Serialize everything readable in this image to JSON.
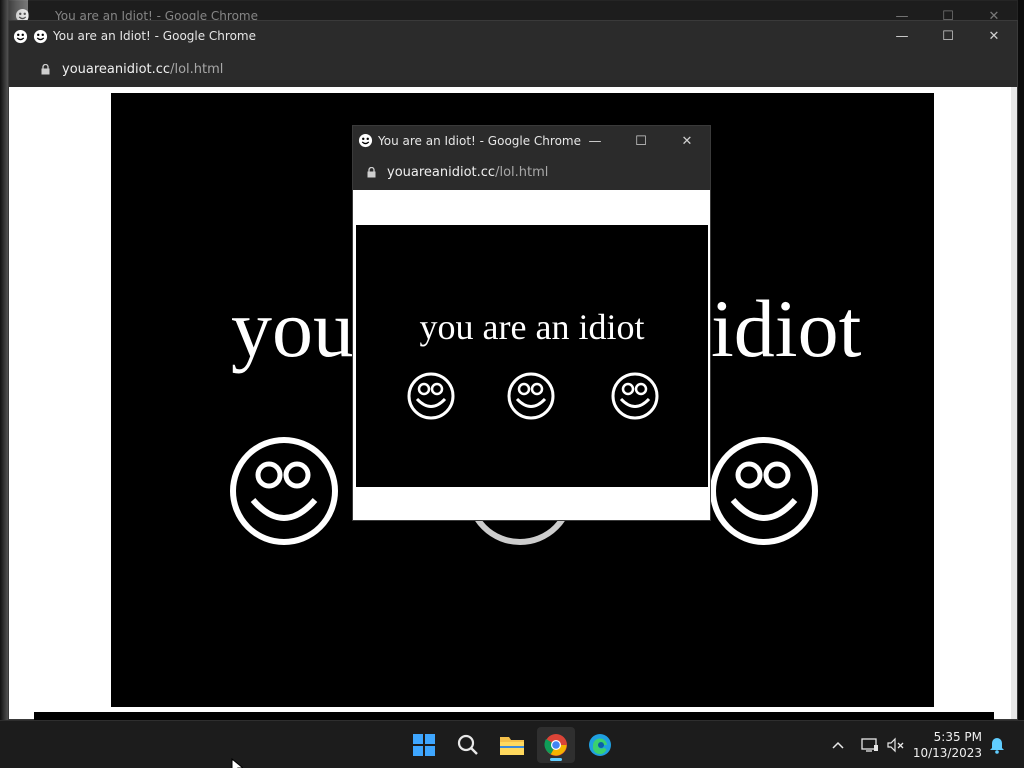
{
  "window": {
    "title": "You are an Idiot! - Google Chrome",
    "url_host": "youareanidiot.cc",
    "url_path": "/lol.html",
    "minimize_glyph": "—",
    "maximize_glyph": "☐",
    "close_glyph": "✕"
  },
  "page": {
    "text": "you are an idiot",
    "large_text_left": "you",
    "large_text_right": "idiot"
  },
  "taskbar": {
    "apps": [
      "start-icon",
      "search-icon",
      "file-explorer-icon",
      "chrome-icon",
      "edge-icon"
    ],
    "time": "5:35 PM",
    "date": "10/13/2023",
    "accent": "#60cdff"
  },
  "colors": {
    "titlebar": "#2b2b2b",
    "page_background": "#000000",
    "page_text": "#ffffff"
  }
}
